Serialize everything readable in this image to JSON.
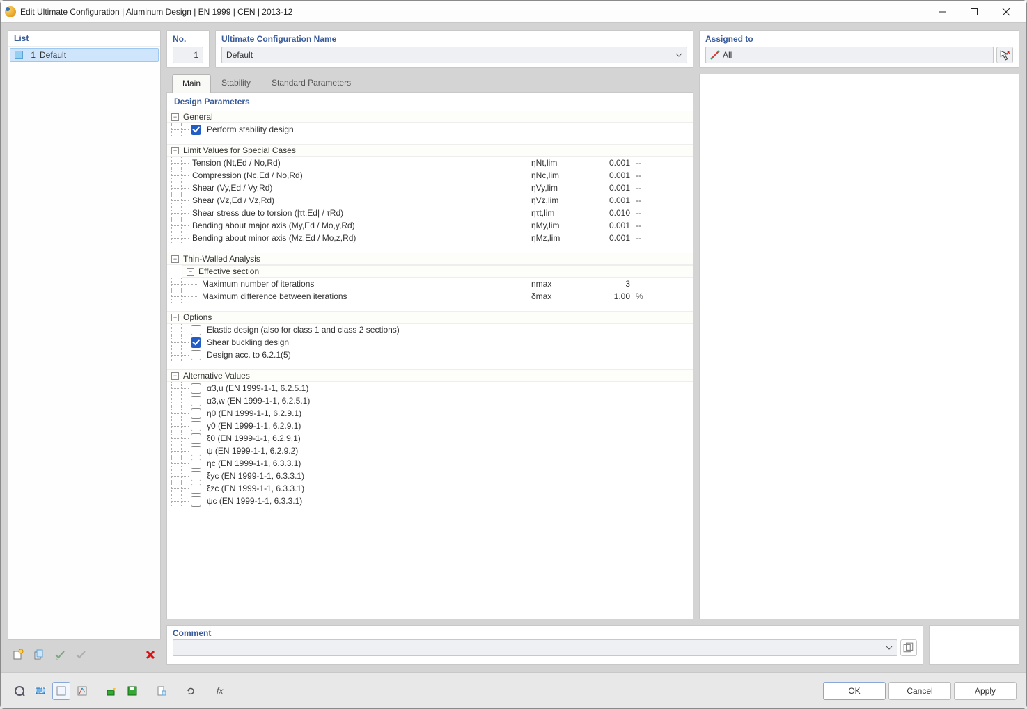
{
  "window": {
    "title": "Edit Ultimate Configuration | Aluminum Design | EN 1999 | CEN | 2013-12"
  },
  "left": {
    "header": "List",
    "item_number": "1",
    "item_name": "Default"
  },
  "top": {
    "no_label": "No.",
    "no_value": "1",
    "name_label": "Ultimate Configuration Name",
    "name_value": "Default",
    "assigned_label": "Assigned to",
    "assigned_value": "All"
  },
  "tabs": {
    "main": "Main",
    "stability": "Stability",
    "standard": "Standard Parameters"
  },
  "section_title": "Design Parameters",
  "groups": {
    "general": "General",
    "general_perform": "Perform stability design",
    "limits": "Limit Values for Special Cases",
    "limits_rows": [
      {
        "label": "Tension (Nt,Ed / No,Rd)",
        "sym": "ηNt,lim",
        "val": "0.001",
        "unit": "--"
      },
      {
        "label": "Compression (Nc,Ed / No,Rd)",
        "sym": "ηNc,lim",
        "val": "0.001",
        "unit": "--"
      },
      {
        "label": "Shear (Vy,Ed / Vy,Rd)",
        "sym": "ηVy,lim",
        "val": "0.001",
        "unit": "--"
      },
      {
        "label": "Shear (Vz,Ed / Vz,Rd)",
        "sym": "ηVz,lim",
        "val": "0.001",
        "unit": "--"
      },
      {
        "label": "Shear stress due to torsion (|τt,Ed| / τRd)",
        "sym": "ητt,lim",
        "val": "0.010",
        "unit": "--"
      },
      {
        "label": "Bending about major axis (My,Ed / Mo,y,Rd)",
        "sym": "ηMy,lim",
        "val": "0.001",
        "unit": "--"
      },
      {
        "label": "Bending about minor axis (Mz,Ed / Mo,z,Rd)",
        "sym": "ηMz,lim",
        "val": "0.001",
        "unit": "--"
      }
    ],
    "thin": "Thin-Walled Analysis",
    "thin_sub": "Effective section",
    "thin_rows": [
      {
        "label": "Maximum number of iterations",
        "sym": "nmax",
        "val": "3",
        "unit": ""
      },
      {
        "label": "Maximum difference between iterations",
        "sym": "δmax",
        "val": "1.00",
        "unit": "%"
      }
    ],
    "options": "Options",
    "options_rows": [
      {
        "label": "Elastic design (also for class 1 and class 2 sections)",
        "checked": false
      },
      {
        "label": "Shear buckling design",
        "checked": true
      },
      {
        "label": "Design acc. to 6.2.1(5)",
        "checked": false
      }
    ],
    "alt": "Alternative Values",
    "alt_rows": [
      {
        "label": "α3,u (EN 1999-1-1, 6.2.5.1)"
      },
      {
        "label": "α3,w (EN 1999-1-1, 6.2.5.1)"
      },
      {
        "label": "η0 (EN 1999-1-1, 6.2.9.1)"
      },
      {
        "label": "γ0 (EN 1999-1-1, 6.2.9.1)"
      },
      {
        "label": "ξ0 (EN 1999-1-1, 6.2.9.1)"
      },
      {
        "label": "ψ (EN 1999-1-1, 6.2.9.2)"
      },
      {
        "label": "ηc (EN 1999-1-1, 6.3.3.1)"
      },
      {
        "label": "ξyc (EN 1999-1-1, 6.3.3.1)"
      },
      {
        "label": "ξzc (EN 1999-1-1, 6.3.3.1)"
      },
      {
        "label": "ψc (EN 1999-1-1, 6.3.3.1)"
      }
    ]
  },
  "comment_label": "Comment",
  "footer": {
    "ok": "OK",
    "cancel": "Cancel",
    "apply": "Apply"
  }
}
